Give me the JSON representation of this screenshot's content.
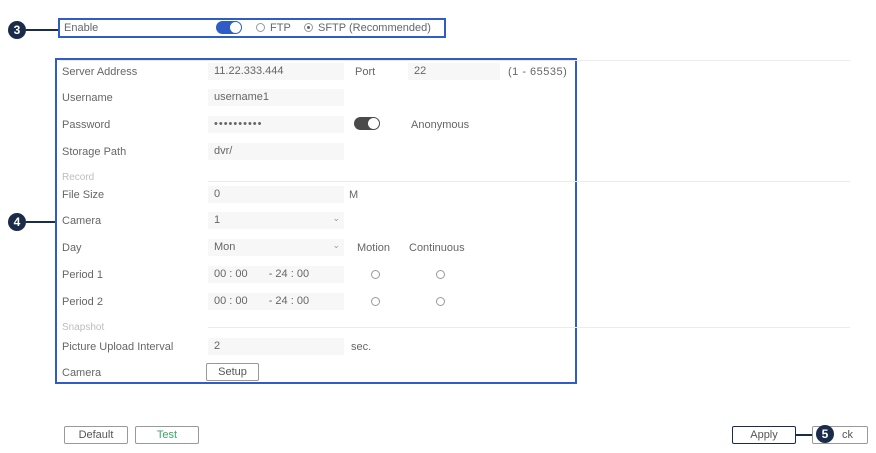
{
  "callouts": {
    "c3": "3",
    "c4": "4",
    "c5": "5"
  },
  "enable_row": {
    "label": "Enable",
    "enabled": true,
    "protocol_ftp": "FTP",
    "protocol_sftp": "SFTP (Recommended)",
    "selected_protocol": "SFTP"
  },
  "server": {
    "address_label": "Server Address",
    "address_value": "11.22.333.444",
    "port_label": "Port",
    "port_value": "22",
    "port_range": "(1 - 65535)",
    "username_label": "Username",
    "username_value": "username1",
    "password_label": "Password",
    "password_value": "••••••••••",
    "anonymous_label": "Anonymous",
    "anonymous_enabled": false,
    "storage_label": "Storage Path",
    "storage_value": "dvr/"
  },
  "record": {
    "section_label": "Record",
    "file_size_label": "File Size",
    "file_size_value": "0",
    "file_size_unit": "M",
    "camera_label": "Camera",
    "camera_value": "1",
    "day_label": "Day",
    "day_value": "Mon",
    "motion_label": "Motion",
    "continuous_label": "Continuous",
    "periods": [
      {
        "label": "Period 1",
        "start": "00 : 00",
        "end": "- 24 : 00"
      },
      {
        "label": "Period 2",
        "start": "00 : 00",
        "end": "- 24 : 00"
      }
    ]
  },
  "snapshot": {
    "section_label": "Snapshot",
    "interval_label": "Picture Upload Interval",
    "interval_value": "2",
    "interval_unit": "sec.",
    "camera_label": "Camera",
    "setup_label": "Setup"
  },
  "footer": {
    "default_label": "Default",
    "test_label": "Test",
    "apply_label": "Apply",
    "back_label_fragment": "ck"
  },
  "colors": {
    "callout": "#1b2c4a",
    "frame": "#2f5cc7",
    "toggle_on": "#2f5cc7",
    "test_text": "#3aa66a"
  }
}
